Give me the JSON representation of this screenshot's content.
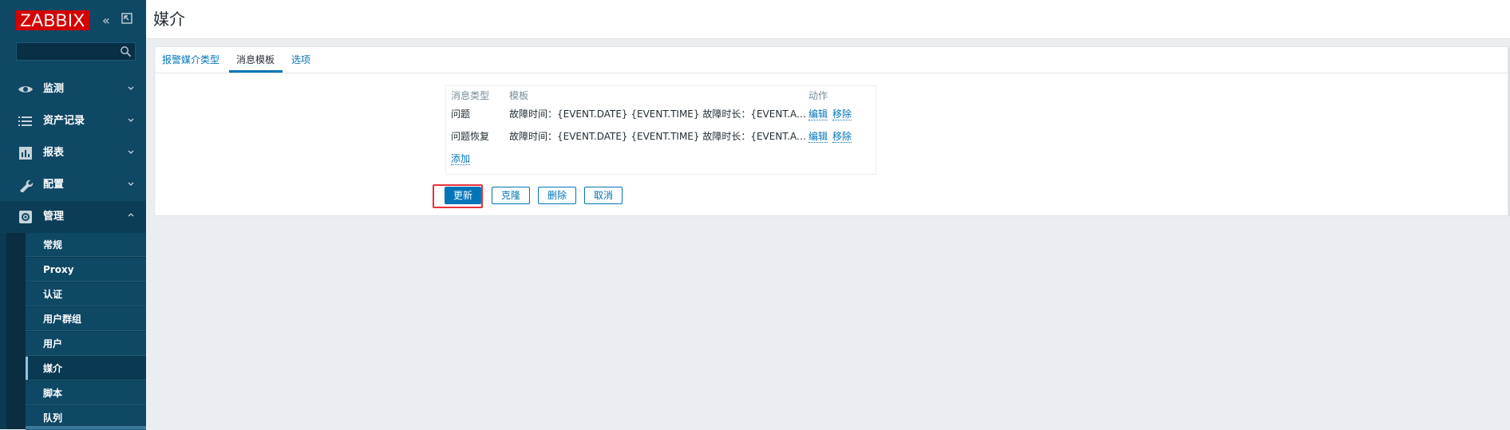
{
  "brand": {
    "logo_text": "ZABBIX"
  },
  "sidebar": {
    "search_placeholder": "",
    "nav": [
      {
        "label": "监测",
        "icon": "eye-icon"
      },
      {
        "label": "资产记录",
        "icon": "list-icon"
      },
      {
        "label": "报表",
        "icon": "bar-chart-icon"
      },
      {
        "label": "配置",
        "icon": "wrench-icon"
      },
      {
        "label": "管理",
        "icon": "gear-icon"
      }
    ],
    "admin_items": [
      "常规",
      "Proxy",
      "认证",
      "用户群组",
      "用户",
      "媒介",
      "脚本",
      "队列"
    ],
    "active_admin_item": "媒介"
  },
  "header": {
    "title": "媒介"
  },
  "tabs": [
    "报警媒介类型",
    "消息模板",
    "选项"
  ],
  "active_tab": "消息模板",
  "templates": {
    "columns": {
      "type": "消息类型",
      "template": "模板",
      "actions": "动作"
    },
    "rows": [
      {
        "type": "问题",
        "template": "故障时间：{EVENT.DATE} {EVENT.TIME} 故障时长：{EVENT.AGE}…",
        "edit": "编辑",
        "remove": "移除"
      },
      {
        "type": "问题恢复",
        "template": "故障时间：{EVENT.DATE} {EVENT.TIME} 故障时长：{EVENT.AGE}…",
        "edit": "编辑",
        "remove": "移除"
      }
    ],
    "add_label": "添加"
  },
  "buttons": {
    "update": "更新",
    "clone": "克隆",
    "delete": "删除",
    "cancel": "取消"
  },
  "colors": {
    "sidebar": "#0e4865",
    "accent": "#0275b8",
    "logo": "#d40000",
    "highlight": "#e8313b"
  }
}
